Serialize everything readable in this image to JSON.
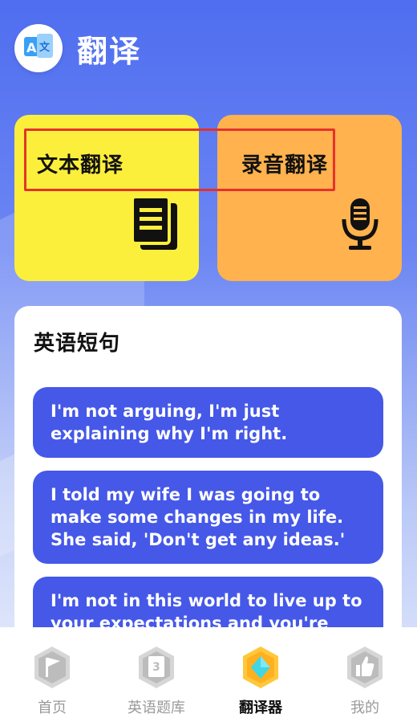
{
  "header": {
    "title": "翻译",
    "logo_icon": "translate-logo-icon"
  },
  "cards": {
    "text_translate": {
      "label": "文本翻译",
      "icon": "document-stack-icon",
      "color": "#fcef3c"
    },
    "voice_translate": {
      "label": "录音翻译",
      "icon": "microphone-icon",
      "color": "#ffb24d"
    }
  },
  "phrases": {
    "title": "英语短句",
    "items": [
      "I'm not arguing, I'm just explaining why I'm right.",
      "I told my wife I was going to make some changes in my life. She said, 'Don't get any ideas.'",
      "I'm not in this world to live up to your expectations and you're not in this"
    ]
  },
  "tabbar": {
    "items": [
      {
        "label": "首页",
        "icon": "flag-icon",
        "active": false
      },
      {
        "label": "英语题库",
        "icon": "question-bank-icon",
        "active": false
      },
      {
        "label": "翻译器",
        "icon": "diamond-icon",
        "active": true
      },
      {
        "label": "我的",
        "icon": "thumbs-up-icon",
        "active": false
      }
    ]
  },
  "colors": {
    "accent": "#4558e8",
    "highlight": "#e5322d"
  }
}
